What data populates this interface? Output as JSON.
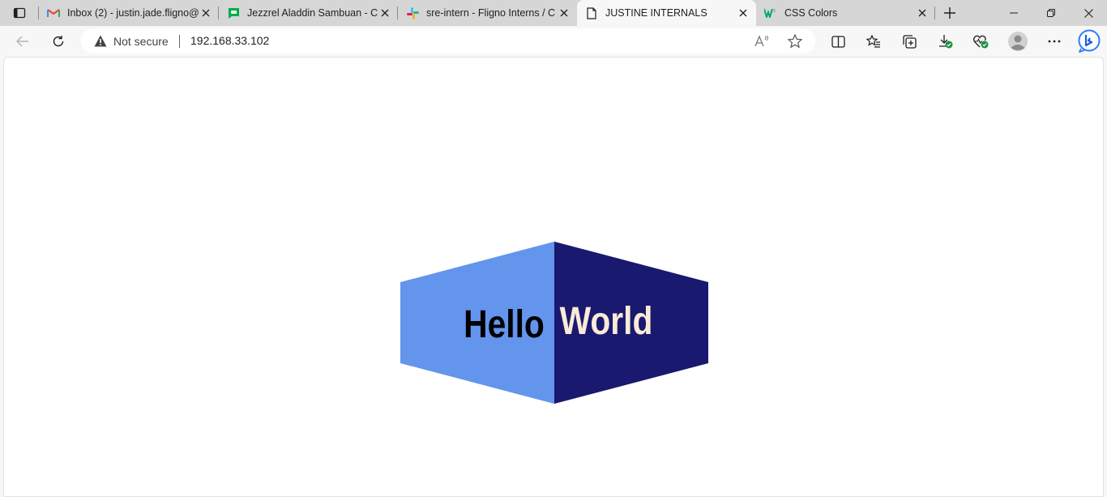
{
  "tabs": [
    {
      "title": "Inbox (2) - justin.jade.fligno@",
      "icon": "gmail-icon",
      "active": false
    },
    {
      "title": "Jezzrel Aladdin Sambuan - Ch",
      "icon": "google-chat-icon",
      "active": false
    },
    {
      "title": "sre-intern - Fligno Interns / C",
      "icon": "slack-icon",
      "active": false
    },
    {
      "title": "JUSTINE INTERNALS",
      "icon": "document-icon",
      "active": true
    },
    {
      "title": "CSS Colors",
      "icon": "w3schools-icon",
      "active": false
    }
  ],
  "addressbar": {
    "security_label": "Not secure",
    "url": "192.168.33.102"
  },
  "page": {
    "left_word": "Hello",
    "right_word": "World",
    "left_color": "#6495ED",
    "right_color": "#191970",
    "left_text_color": "#000000",
    "right_text_color": "#FAEBD7"
  }
}
